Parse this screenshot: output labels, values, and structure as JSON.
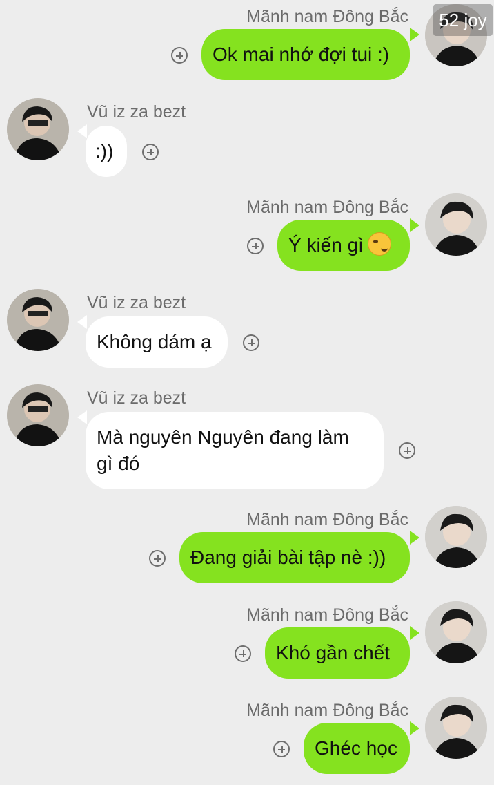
{
  "watermark": "52 joy",
  "users": {
    "me": {
      "name": "Mãnh nam Đông Bắc"
    },
    "other": {
      "name": "Vũ iz za bezt"
    }
  },
  "messages": [
    {
      "sender": "Mãnh nam Đông Bắc",
      "text": "Ok mai nhớ đợi tui :)"
    },
    {
      "sender": "Vũ iz za bezt",
      "text": ":))"
    },
    {
      "sender": "Mãnh nam Đông Bắc",
      "text": "Ý kiến gì",
      "emoji": "smirk-emoji"
    },
    {
      "sender": "Vũ iz za bezt",
      "text": "Không dám ạ"
    },
    {
      "sender": "Vũ iz za bezt",
      "text_line1": "Mà nguyên Nguyên đang làm",
      "text_line2": "gì đó"
    },
    {
      "sender": "Mãnh nam Đông Bắc",
      "text": "Đang giải bài tập nè :))"
    },
    {
      "sender": "Mãnh nam Đông Bắc",
      "text": "Khó gần chết"
    },
    {
      "sender": "Mãnh nam Đông Bắc",
      "text": "Ghéc học"
    }
  ],
  "colors": {
    "background": "#ededed",
    "my_bubble": "#85e21f",
    "other_bubble": "#ffffff",
    "name_text": "#6b6b6b"
  }
}
